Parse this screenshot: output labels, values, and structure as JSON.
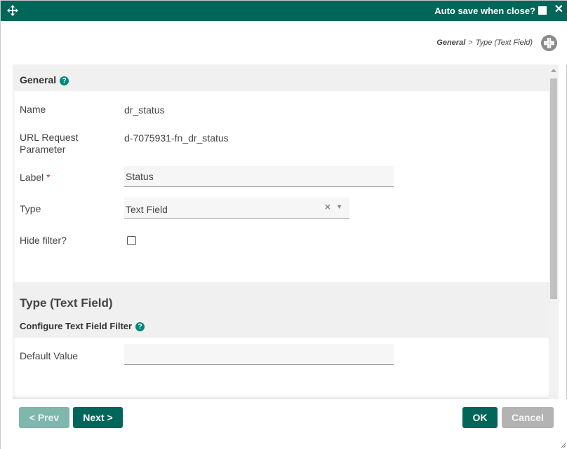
{
  "titlebar": {
    "autosave_label": "Auto save when close?",
    "move_icon": "move-arrows-icon",
    "close_icon": "close-icon",
    "close_glyph": "✕",
    "background": "#00665a"
  },
  "breadcrumb": {
    "items": [
      "General",
      "Type (Text Field)"
    ],
    "separator": ">"
  },
  "general": {
    "title": "General",
    "help_glyph": "?",
    "name_label": "Name",
    "name_value": "dr_status",
    "url_label": "URL Request Parameter",
    "url_value": "d-7075931-fn_dr_status",
    "label_label": "Label",
    "required_mark": "*",
    "label_value": "Status",
    "type_label": "Type",
    "type_value": "Text Field",
    "clear_glyph": "×",
    "caret_glyph": "▼",
    "hide_filter_label": "Hide filter?"
  },
  "type_section": {
    "title": "Type (Text Field)",
    "subtitle": "Configure Text Field Filter",
    "default_value_label": "Default Value",
    "default_value": ""
  },
  "footer": {
    "prev_label": "< Prev",
    "next_label": "Next >",
    "ok_label": "OK",
    "cancel_label": "Cancel"
  },
  "colors": {
    "primary": "#00665a",
    "primary_disabled": "#7fb7ad",
    "help": "#00897b",
    "cancel": "#b3b3b3",
    "required": "#d9232d"
  }
}
